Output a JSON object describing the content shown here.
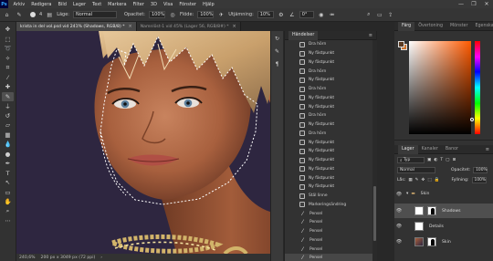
{
  "menubar": {
    "logo": "Ps",
    "items": [
      "Arkiv",
      "Redigera",
      "Bild",
      "Lager",
      "Text",
      "Markera",
      "Filter",
      "3D",
      "Visa",
      "Fönster",
      "Hjälp"
    ],
    "controls": [
      "—",
      "❐",
      "✕"
    ]
  },
  "options": {
    "brush_size": "4",
    "layer_label": "Läge:",
    "mode": "Normal",
    "opacity_label": "Opacitet:",
    "opacity": "100%",
    "flow_label": "Flöde:",
    "flow": "100%",
    "smoothing_label": "Utjämning:",
    "smoothing": "10%",
    "angle": "0°"
  },
  "tabs": [
    {
      "label": "krista in del vol.psd vid 241% (Shadows, RGB/8) *",
      "active": true,
      "close": "×"
    },
    {
      "label": "Namnlöst-1 vid 45% (Lager 56, RGB/8#) *",
      "active": false,
      "close": "×"
    }
  ],
  "status": {
    "zoom": "240,6%",
    "doc": "200 px x 3049 px (72 ppi)",
    "arrow": "›"
  },
  "history": {
    "tab": "Händelser",
    "menu": "≡",
    "items": [
      "Dra hörn",
      "Ny fästpunkt",
      "Ny fästpunkt",
      "Dra hörn",
      "Ny fästpunkt",
      "Dra hörn",
      "Ny fästpunkt",
      "Ny fästpunkt",
      "Dra hörn",
      "Ny fästpunkt",
      "Dra hörn",
      "Ny fästpunkt",
      "Ny fästpunkt",
      "Ny fästpunkt",
      "Ny fästpunkt",
      "Ny fästpunkt",
      "Ny fästpunkt",
      "Stäl linne",
      "Markeringsändring",
      "Pensel",
      "Pensel",
      "Pensel",
      "Pensel",
      "Pensel",
      "Pensel"
    ]
  },
  "color": {
    "tabs": [
      "Färg",
      "Övertoning",
      "Mönster",
      "Egenskaper"
    ],
    "menu": "≡",
    "foreground": "#5a3a22",
    "background": "#cc7530"
  },
  "layers": {
    "tabs": [
      "Lager",
      "Kanaler",
      "Banor"
    ],
    "menu": "≡",
    "filter_label": "Typ",
    "blend_mode": "Normal",
    "opacity_label": "Opacitet:",
    "opacity": "100%",
    "lock_label": "Lås:",
    "fill_label": "Fyllning:",
    "fill": "100%",
    "rows": [
      {
        "name": "Skin",
        "type": "group"
      },
      {
        "name": "Shadows",
        "type": "masked",
        "selected": true
      },
      {
        "name": "Details",
        "type": "plain"
      },
      {
        "name": "Skin",
        "type": "masked"
      }
    ]
  },
  "toolbar": {
    "tools": [
      "move",
      "marquee",
      "lasso",
      "quick-select",
      "crop",
      "eyedropper",
      "healing",
      "brush",
      "clone",
      "history-brush",
      "eraser",
      "gradient",
      "blur",
      "dodge",
      "pen",
      "type",
      "path-select",
      "shape",
      "hand",
      "zoom",
      "more"
    ]
  }
}
